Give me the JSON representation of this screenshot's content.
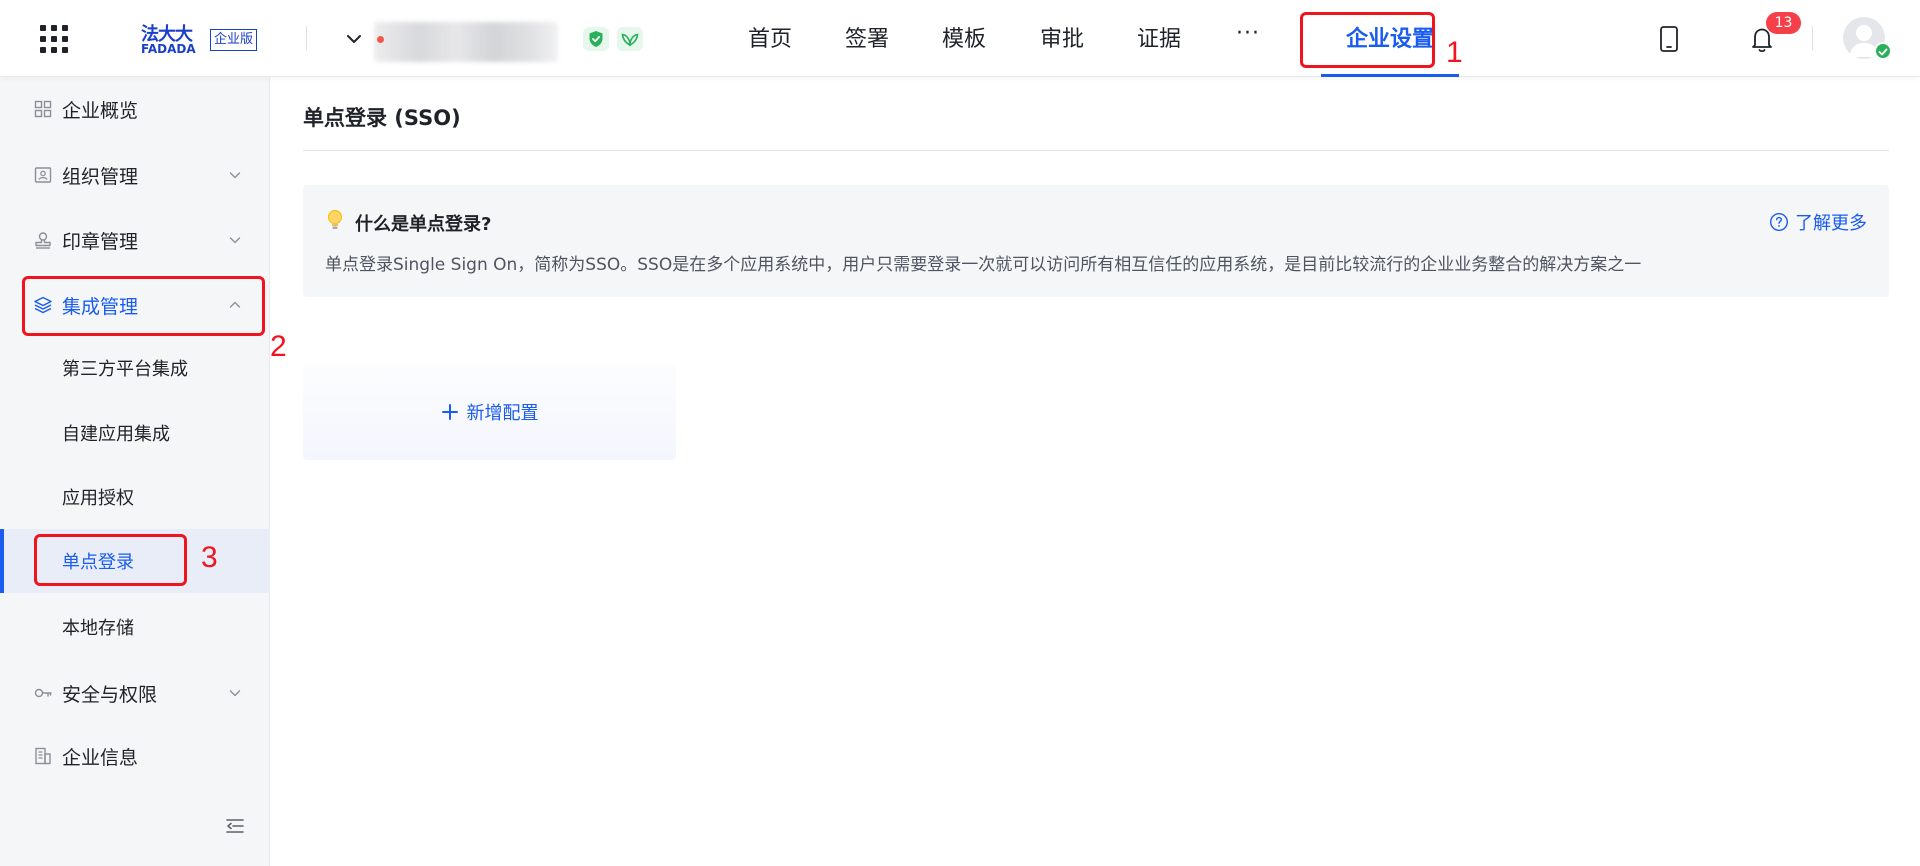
{
  "header": {
    "logo_cn": "法大大",
    "logo_en": "FADADA",
    "logo_badge": "企业版",
    "nav": [
      "首页",
      "签署",
      "模板",
      "审批",
      "证据",
      "···"
    ],
    "active_nav": "企业设置",
    "notification_count": "13",
    "icons": [
      "apps-grid-icon",
      "chevron-down-icon",
      "shield-check-icon",
      "leaf-icon",
      "tablet-icon",
      "bell-icon",
      "avatar-icon"
    ]
  },
  "sidebar": {
    "items": [
      {
        "label": "企业概览",
        "icon": "overview-icon"
      },
      {
        "label": "组织管理",
        "icon": "org-icon"
      },
      {
        "label": "印章管理",
        "icon": "stamp-icon"
      },
      {
        "label": "集成管理",
        "icon": "layers-icon"
      },
      {
        "label": "第三方平台集成"
      },
      {
        "label": "自建应用集成"
      },
      {
        "label": "应用授权"
      },
      {
        "label": "单点登录"
      },
      {
        "label": "本地存储"
      },
      {
        "label": "安全与权限",
        "icon": "key-icon"
      },
      {
        "label": "企业信息",
        "icon": "building-icon"
      }
    ]
  },
  "annotations": [
    "1",
    "2",
    "3"
  ],
  "main": {
    "title": "单点登录 (SSO)",
    "info_title": "什么是单点登录?",
    "info_text": "单点登录Single Sign On，简称为SSO。SSO是在多个应用系统中，用户只需要登录一次就可以访问所有相互信任的应用系统，是目前比较流行的企业业务整合的解决方案之一",
    "learn_more": "了解更多",
    "add_config": "新增配置"
  },
  "colors": {
    "primary": "#1a5cf0",
    "highlight": "#f0141e",
    "badge": "#f5404a",
    "success": "#2ab05a"
  }
}
